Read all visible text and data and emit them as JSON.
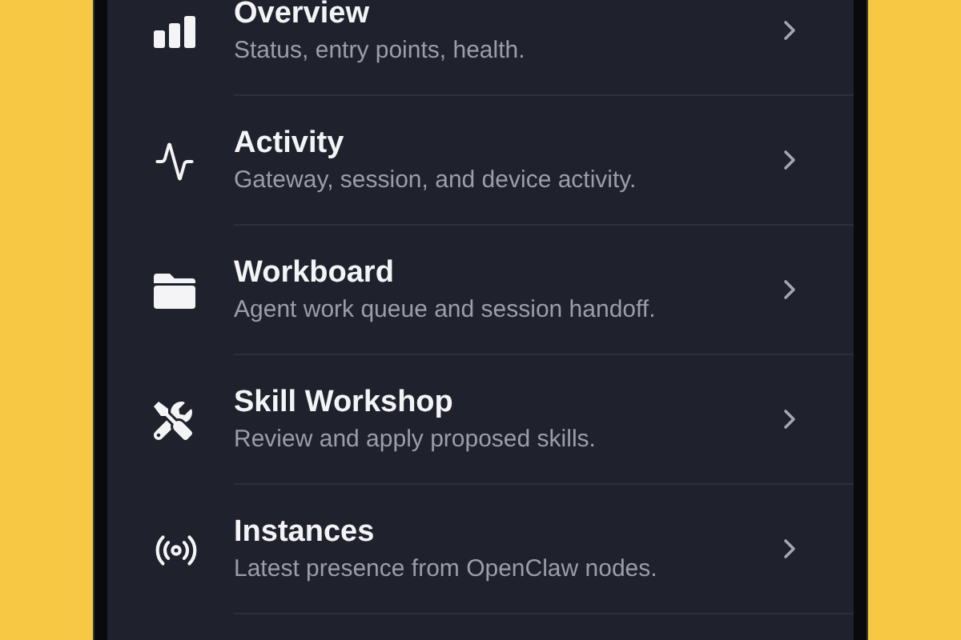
{
  "menu": [
    {
      "title": "Overview",
      "subtitle": "Status, entry points, health."
    },
    {
      "title": "Activity",
      "subtitle": "Gateway, session, and device activity."
    },
    {
      "title": "Workboard",
      "subtitle": "Agent work queue and session handoff."
    },
    {
      "title": "Skill Workshop",
      "subtitle": "Review and apply proposed skills."
    },
    {
      "title": "Instances",
      "subtitle": "Latest presence from OpenClaw nodes."
    }
  ]
}
